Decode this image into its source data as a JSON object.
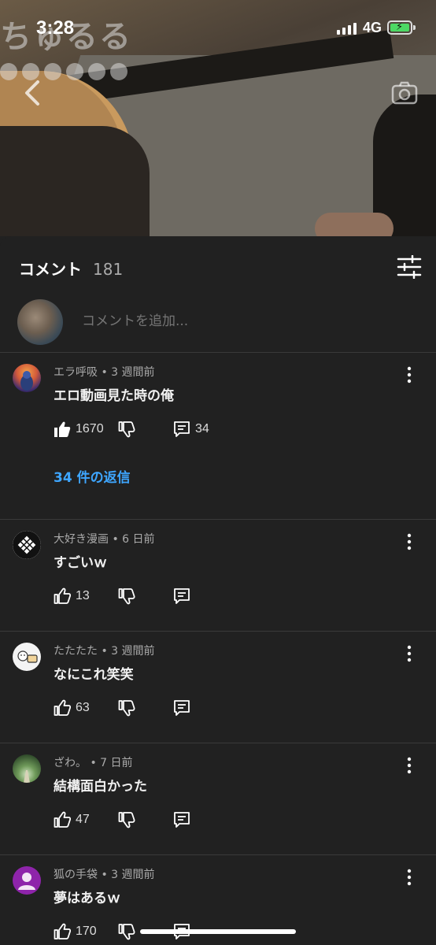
{
  "status": {
    "time": "3:28",
    "network": "4G"
  },
  "video": {
    "logo_text": "ちゅるる"
  },
  "comments_header": {
    "title": "コメント",
    "count": "181"
  },
  "add_comment": {
    "placeholder": "コメントを追加..."
  },
  "comments": [
    {
      "author": "エラ呼吸",
      "age": "3 週間前",
      "text": "エロ動画見た時の俺",
      "likes": "1670",
      "liked": true,
      "reply_count": "34",
      "replies_link": "34 件の返信"
    },
    {
      "author": "大好き漫画",
      "age": "6 日前",
      "text": "すごいｗ",
      "likes": "13",
      "liked": false,
      "reply_count": ""
    },
    {
      "author": "たたたた",
      "age": "3 週間前",
      "text": "なにこれ笑笑",
      "likes": "63",
      "liked": false,
      "reply_count": ""
    },
    {
      "author": "ざわ。",
      "age": "7 日前",
      "text": "結構面白かった",
      "likes": "47",
      "liked": false,
      "reply_count": ""
    },
    {
      "author": "狐の手袋",
      "age": "3 週間前",
      "text": "夢はあるｗ",
      "likes": "170",
      "liked": false,
      "reply_count": ""
    }
  ],
  "meta_separator": "•",
  "colors": {
    "background": "#212121",
    "link": "#3ea6ff",
    "muted": "#aaaaaa",
    "battery": "#4cd964"
  }
}
